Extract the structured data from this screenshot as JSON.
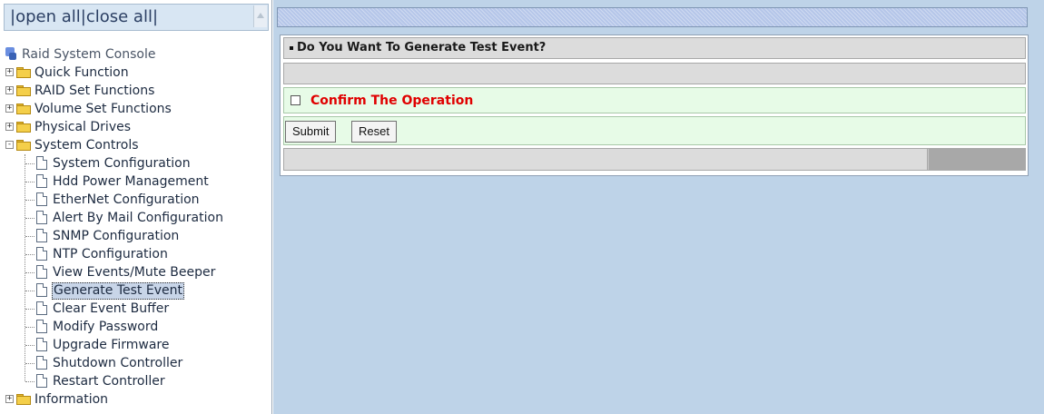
{
  "left": {
    "open_all": "open all",
    "close_all": "close all",
    "separator": "|",
    "root": "Raid System Console",
    "folders": [
      {
        "label": "Quick Function",
        "expander": "+"
      },
      {
        "label": "RAID Set Functions",
        "expander": "+"
      },
      {
        "label": "Volume Set Functions",
        "expander": "+"
      },
      {
        "label": "Physical Drives",
        "expander": "+"
      },
      {
        "label": "System Controls",
        "expander": "-"
      }
    ],
    "system_controls_items": [
      "System Configuration",
      "Hdd Power Management",
      "EtherNet Configuration",
      "Alert By Mail Configuration",
      "SNMP Configuration",
      "NTP Configuration",
      "View Events/Mute Beeper",
      "Generate Test Event",
      "Clear Event Buffer",
      "Modify Password",
      "Upgrade Firmware",
      "Shutdown Controller",
      "Restart Controller"
    ],
    "selected_item": "Generate Test Event",
    "last_folder": {
      "label": "Information",
      "expander": "+"
    }
  },
  "panel": {
    "title": "Do You Want To Generate Test Event?",
    "confirm_label": "Confirm The Operation",
    "confirm_checked": false,
    "submit_label": "Submit",
    "reset_label": "Reset"
  },
  "colors": {
    "confirm_text": "#e00000",
    "green_row": "#e7fbe7",
    "right_bg": "#bed3e8"
  }
}
